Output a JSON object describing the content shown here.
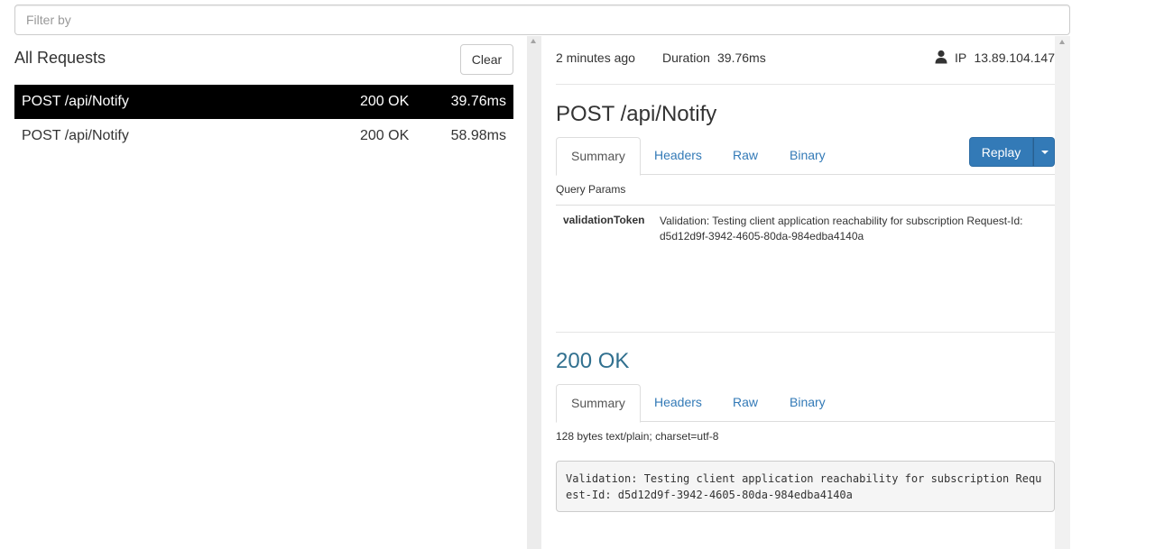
{
  "filter": {
    "placeholder": "Filter by"
  },
  "requests_panel": {
    "title": "All Requests",
    "clear_label": "Clear",
    "items": [
      {
        "method_path": "POST /api/Notify",
        "status": "200 OK",
        "duration": "39.76ms",
        "selected": true
      },
      {
        "method_path": "POST /api/Notify",
        "status": "200 OK",
        "duration": "58.98ms",
        "selected": false
      }
    ]
  },
  "detail": {
    "time_ago": "2 minutes ago",
    "duration_label": "Duration",
    "duration": "39.76ms",
    "ip_label": "IP",
    "ip": "13.89.104.147",
    "request_title": "POST /api/Notify",
    "replay_label": "Replay",
    "request_tabs": [
      "Summary",
      "Headers",
      "Raw",
      "Binary"
    ],
    "query_params_label": "Query Params",
    "query_params": [
      {
        "key": "validationToken",
        "value": "Validation: Testing client application reachability for subscription Request-Id: d5d12d9f-3942-4605-80da-984edba4140a"
      }
    ],
    "response_title": "200 OK",
    "response_tabs": [
      "Summary",
      "Headers",
      "Raw",
      "Binary"
    ],
    "response_meta": "128 bytes text/plain; charset=utf-8",
    "response_body": "Validation: Testing client application reachability for subscription Request-Id: d5d12d9f-3942-4605-80da-984edba4140a"
  },
  "colors": {
    "selected_row_bg": "#000000",
    "link": "#337ab7",
    "response_status": "#31708f",
    "primary_button": "#337ab7"
  },
  "icons": {
    "user": "user-icon",
    "caret": "caret-down-icon"
  }
}
